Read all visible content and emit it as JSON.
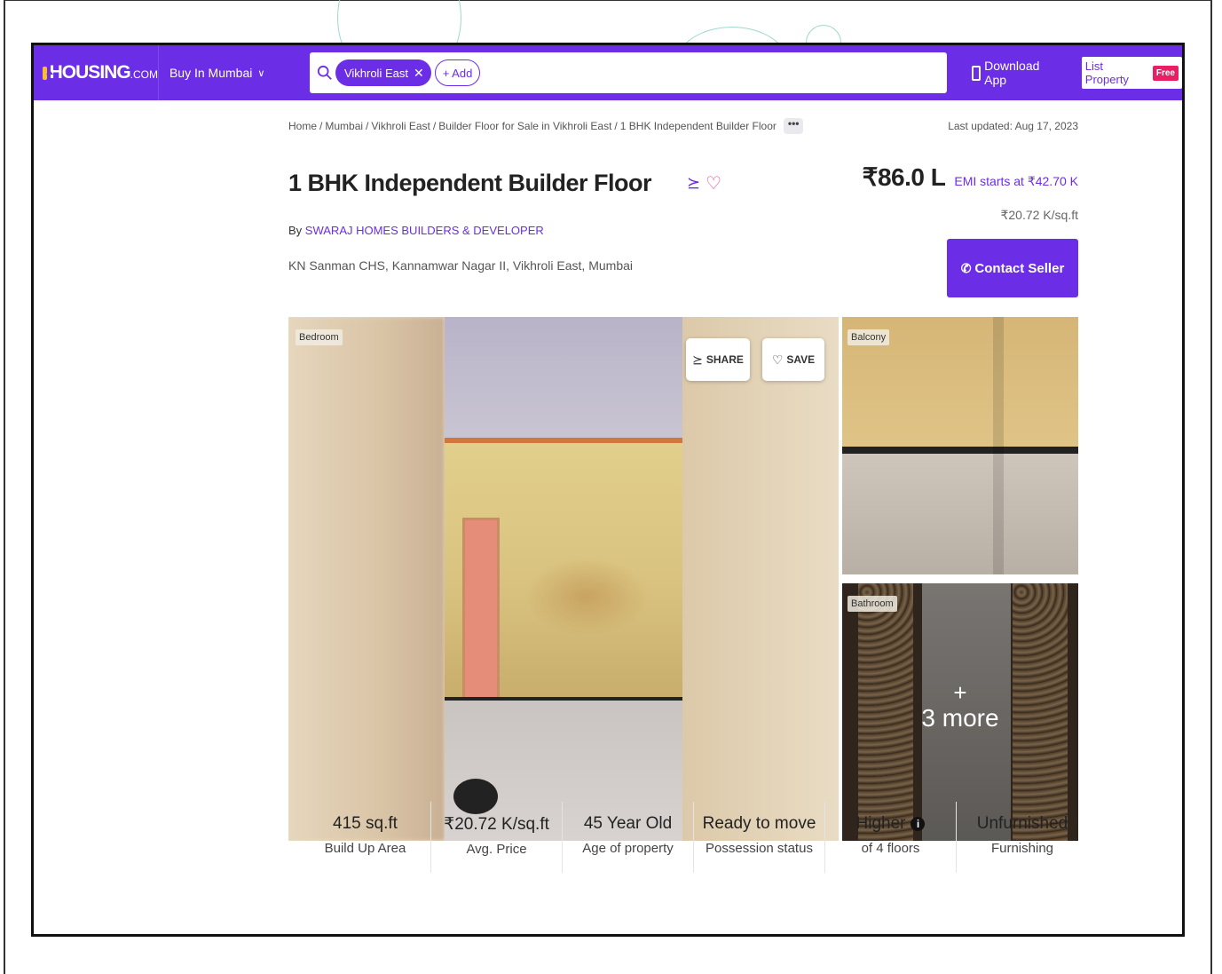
{
  "brand": {
    "name": "HOUSING",
    "suffix": ".COM"
  },
  "nav": {
    "city_label": "Buy In Mumbai",
    "search_chip": "Vikhroli East",
    "add_label": "+ Add",
    "download_label": "Download App",
    "list_property_label": "List Property",
    "free_badge": "Free"
  },
  "breadcrumb": [
    "Home",
    "Mumbai",
    "Vikhroli East",
    "Builder Floor for Sale in Vikhroli East",
    "1 BHK Independent Builder Floor"
  ],
  "more_label": "•••",
  "last_updated": "Last updated: Aug 17, 2023",
  "listing": {
    "title": "1 BHK Independent Builder Floor",
    "by_prefix": "By",
    "seller": "SWARAJ HOMES BUILDERS & DEVELOPER",
    "address": "KN Sanman CHS, Kannamwar Nagar II, Vikhroli East, Mumbai",
    "price": "₹86.0 L",
    "emi": "EMI starts at ₹42.70 K",
    "per_sqft": "₹20.72 K/sq.ft",
    "contact_label": "Contact Seller"
  },
  "gallery": {
    "main_tag": "Bedroom",
    "share_label": "SHARE",
    "save_label": "SAVE",
    "side_tag_1": "Balcony",
    "side_tag_2": "Bathroom",
    "more_plus": "+",
    "more_count": "3 more"
  },
  "facts": [
    {
      "value": "415 sq.ft",
      "label": "Build Up Area"
    },
    {
      "value": "₹20.72 K/sq.ft",
      "label": "Avg. Price"
    },
    {
      "value": "45 Year Old",
      "label": "Age of property"
    },
    {
      "value": "Ready to move",
      "label": "Possession status"
    },
    {
      "value": "Higher",
      "label": "of 4 floors"
    },
    {
      "value": "Unfurnished",
      "label": "Furnishing"
    }
  ],
  "colors": {
    "brand": "#6b2ee6",
    "logo_accent": "#fdbc2b",
    "free_badge": "#e91e63"
  },
  "icons": [
    "search-icon",
    "close-icon",
    "phone-icon",
    "share-icon",
    "heart-icon",
    "call-icon",
    "info-icon",
    "chevron-down-icon"
  ]
}
